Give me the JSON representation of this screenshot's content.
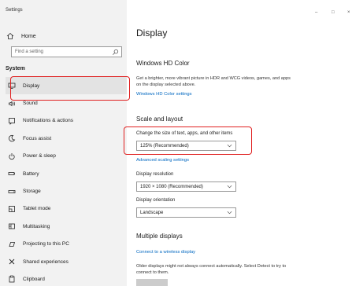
{
  "window": {
    "title": "Settings",
    "minimize": "–",
    "maximize": "□",
    "close": "×"
  },
  "sidebar": {
    "home": "Home",
    "search_placeholder": "Find a setting",
    "section": "System",
    "items": [
      {
        "label": "Display",
        "icon": "monitor-icon"
      },
      {
        "label": "Sound",
        "icon": "speaker-icon"
      },
      {
        "label": "Notifications & actions",
        "icon": "notification-icon"
      },
      {
        "label": "Focus assist",
        "icon": "moon-icon"
      },
      {
        "label": "Power & sleep",
        "icon": "power-icon"
      },
      {
        "label": "Battery",
        "icon": "battery-icon"
      },
      {
        "label": "Storage",
        "icon": "storage-icon"
      },
      {
        "label": "Tablet mode",
        "icon": "tablet-icon"
      },
      {
        "label": "Multitasking",
        "icon": "multitasking-icon"
      },
      {
        "label": "Projecting to this PC",
        "icon": "projector-icon"
      },
      {
        "label": "Shared experiences",
        "icon": "shared-icon"
      },
      {
        "label": "Clipboard",
        "icon": "clipboard-icon"
      }
    ]
  },
  "main": {
    "title": "Display",
    "hd_color": {
      "heading": "Windows HD Color",
      "description": "Get a brighter, more vibrant picture in HDR and WCG videos, games, and apps on the display selected above.",
      "link": "Windows HD Color settings"
    },
    "scale": {
      "heading": "Scale and layout",
      "scale_label": "Change the size of text, apps, and other items",
      "scale_value": "125% (Recommended)",
      "advanced_link": "Advanced scaling settings",
      "resolution_label": "Display resolution",
      "resolution_value": "1920 × 1080 (Recommended)",
      "orientation_label": "Display orientation",
      "orientation_value": "Landscape"
    },
    "multiple": {
      "heading": "Multiple displays",
      "connect_link": "Connect to a wireless display",
      "description": "Older displays might not always connect automatically. Select Detect to try to connect to them."
    }
  }
}
